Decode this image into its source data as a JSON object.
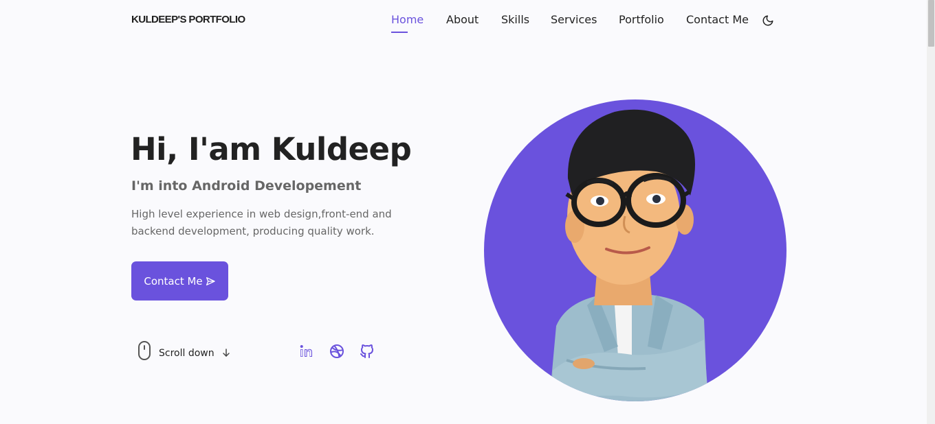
{
  "header": {
    "logo": "KULDEEP'S PORTFOLIO",
    "nav": [
      {
        "label": "Home",
        "active": true
      },
      {
        "label": "About"
      },
      {
        "label": "Skills"
      },
      {
        "label": "Services"
      },
      {
        "label": "Portfolio"
      },
      {
        "label": "Contact Me"
      }
    ],
    "theme_toggle_icon": "moon-icon"
  },
  "hero": {
    "title": "Hi, I'am Kuldeep",
    "subtitle": "I'm into Android Developement",
    "description_lines": [
      "High level experience in web design,front-end and",
      "backend development, producing quality work."
    ],
    "contact_button": "Contact Me",
    "contact_button_icon": "send-icon",
    "scroll_down": "Scroll down",
    "social_icons": [
      "linkedin-icon",
      "dribbble-icon",
      "github-icon"
    ]
  },
  "colors": {
    "accent": "#6a52dd",
    "background": "#fafafd",
    "text": "#222222",
    "muted_text": "#666666"
  }
}
